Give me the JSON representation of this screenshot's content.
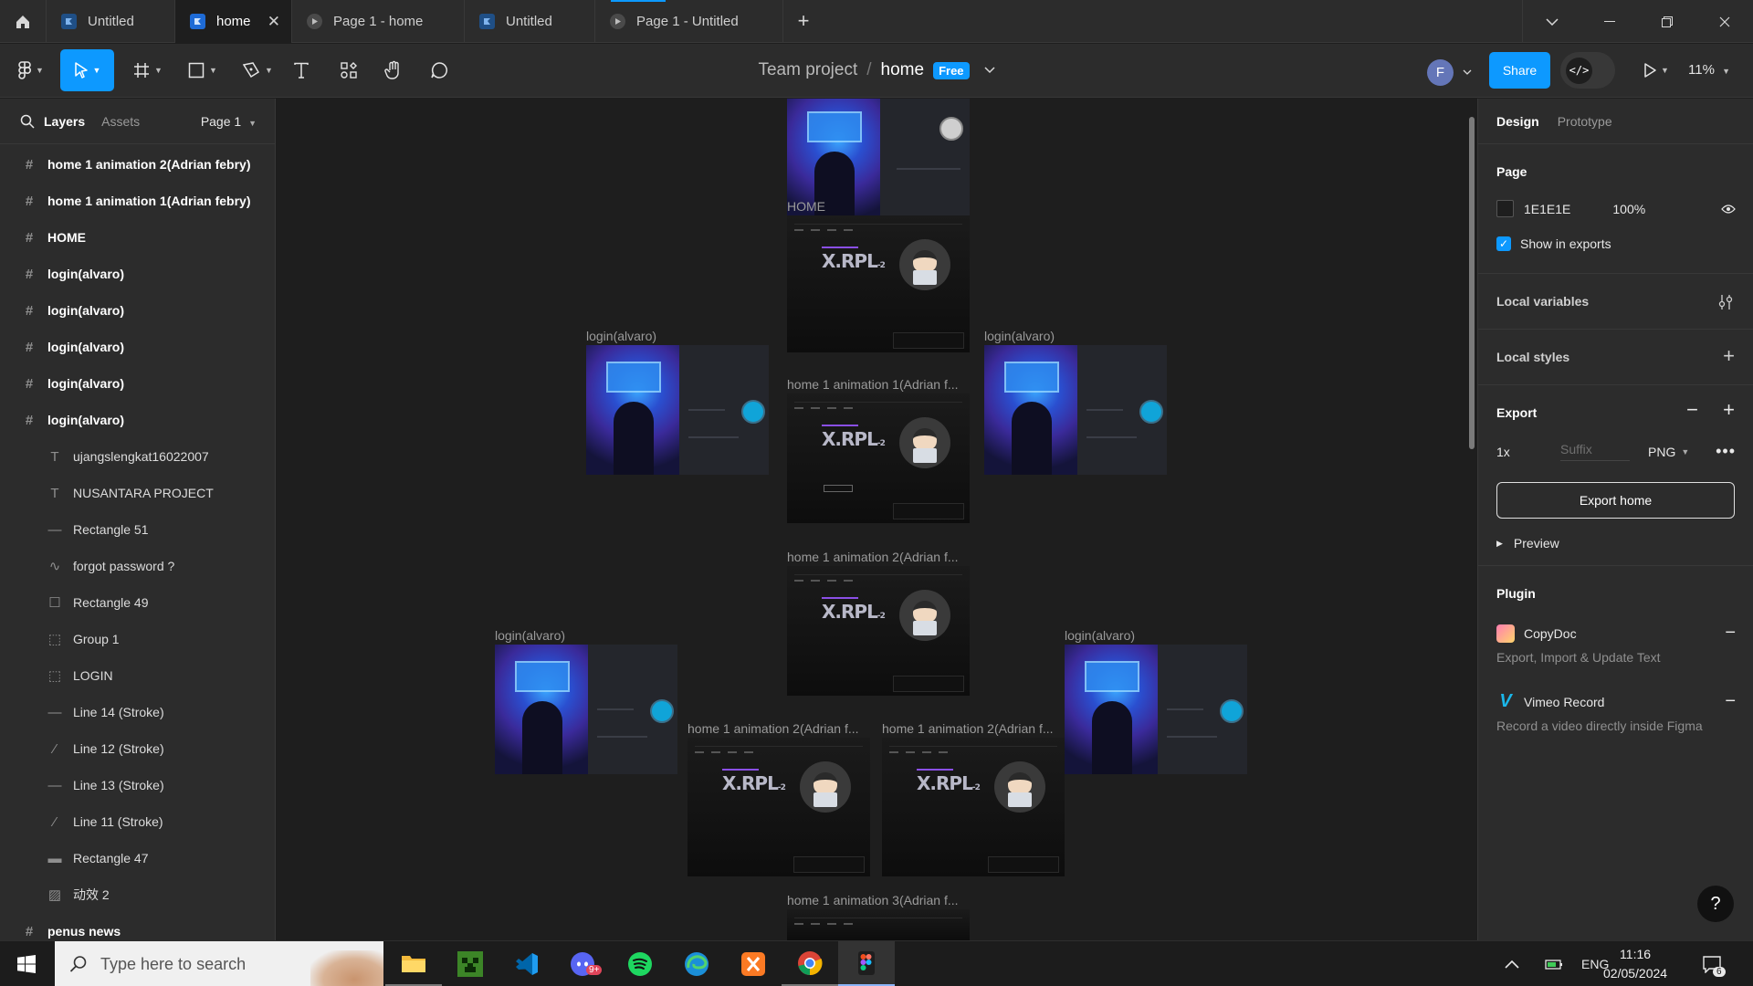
{
  "tabs": [
    {
      "label": "Untitled",
      "icon": "figma-file-icon",
      "active": false
    },
    {
      "label": "home",
      "icon": "figma-file-icon",
      "active": true
    },
    {
      "label": "Page 1 - home",
      "icon": "prototype-play-icon",
      "active": false
    },
    {
      "label": "Untitled",
      "icon": "figma-file-icon",
      "active": false
    },
    {
      "label": "Page 1 - Untitled",
      "icon": "prototype-play-icon",
      "active": false
    }
  ],
  "toolbar": {
    "project": "Team project",
    "separator": "/",
    "file": "home",
    "plan_badge": "Free",
    "avatar_initial": "F",
    "share_label": "Share",
    "dev_mode_glyph": "</>",
    "zoom": "11%"
  },
  "left_panel": {
    "tab_layers": "Layers",
    "tab_assets": "Assets",
    "page_selector": "Page 1",
    "layers": [
      {
        "name": "home 1 animation 2(Adrian febry)",
        "type": "frame"
      },
      {
        "name": "home 1 animation 1(Adrian febry)",
        "type": "frame"
      },
      {
        "name": "HOME",
        "type": "frame"
      },
      {
        "name": "login(alvaro)",
        "type": "frame"
      },
      {
        "name": "login(alvaro)",
        "type": "frame"
      },
      {
        "name": "login(alvaro)",
        "type": "frame"
      },
      {
        "name": "login(alvaro)",
        "type": "frame"
      },
      {
        "name": "login(alvaro)",
        "type": "frame"
      },
      {
        "name": "ujangslengkat16022007",
        "type": "text"
      },
      {
        "name": "NUSANTARA PROJECT",
        "type": "text"
      },
      {
        "name": "Rectangle 51",
        "type": "line"
      },
      {
        "name": "forgot password ?",
        "type": "vector"
      },
      {
        "name": "Rectangle 49",
        "type": "rectangle"
      },
      {
        "name": "Group 1",
        "type": "group"
      },
      {
        "name": "LOGIN",
        "type": "group"
      },
      {
        "name": "Line 14 (Stroke)",
        "type": "line"
      },
      {
        "name": "Line 12 (Stroke)",
        "type": "diagonal-line"
      },
      {
        "name": "Line 13 (Stroke)",
        "type": "line"
      },
      {
        "name": "Line 11 (Stroke)",
        "type": "diagonal-line"
      },
      {
        "name": "Rectangle 47",
        "type": "line"
      },
      {
        "name": "动效 2",
        "type": "image"
      },
      {
        "name": "penus news",
        "type": "frame"
      }
    ]
  },
  "canvas": {
    "frame_labels": {
      "home": "HOME",
      "login": "login(alvaro)",
      "home_anim1": "home 1 animation 1(Adrian f...",
      "home_anim2": "home 1 animation 2(Adrian f...",
      "home_anim3": "home 1 animation 3(Adrian f..."
    },
    "logo_text": "X.RPL",
    "logo_suffix": "-2"
  },
  "right_panel": {
    "tab_design": "Design",
    "tab_prototype": "Prototype",
    "page_title": "Page",
    "page_color_hex": "1E1E1E",
    "page_opacity": "100%",
    "show_in_exports": "Show in exports",
    "local_variables": "Local variables",
    "local_styles": "Local styles",
    "export_title": "Export",
    "export_scale": "1x",
    "export_suffix_placeholder": "Suffix",
    "export_format": "PNG",
    "export_button": "Export home",
    "preview": "Preview",
    "plugin_title": "Plugin",
    "plugins": [
      {
        "name": "CopyDoc",
        "desc": "Export, Import & Update Text"
      },
      {
        "name": "Vimeo Record",
        "desc": "Record a video directly inside Figma"
      }
    ],
    "help_glyph": "?"
  },
  "taskbar": {
    "search_placeholder": "Type here to search",
    "apps": [
      "file-explorer-icon",
      "minecraft-icon",
      "vscode-icon",
      "discord-icon",
      "spotify-icon",
      "edge-icon",
      "xampp-icon",
      "chrome-icon",
      "figma-icon"
    ],
    "discord_badge": "9+",
    "language": "ENG",
    "time": "11:16",
    "date": "02/05/2024",
    "notification_count": "6"
  },
  "colors": {
    "accent": "#0d99ff",
    "canvas_bg": "#1e1e1e",
    "panel_bg": "#2c2c2c"
  }
}
